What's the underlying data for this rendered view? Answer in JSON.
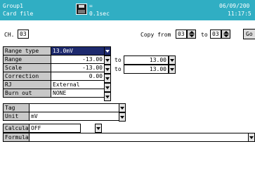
{
  "header": {
    "group": "Group1",
    "media": "Card file",
    "rate_mark": "=",
    "interval": "0.1sec",
    "date": "06/09/200",
    "time": "11:17:5"
  },
  "channel": {
    "label": "CH.",
    "value": "03"
  },
  "copy": {
    "from_label": "Copy from",
    "from_value": "03",
    "to_label": "to",
    "to_value": "03",
    "go_label": "Go"
  },
  "range": {
    "rows": [
      {
        "label": "Range type",
        "value": "13.0mV"
      },
      {
        "label": "Range",
        "value": "-13.00"
      },
      {
        "label": "Scale",
        "value": "-13.00"
      },
      {
        "label": "Correction",
        "value": "0.00"
      },
      {
        "label": "RJ",
        "value": "External"
      },
      {
        "label": "Burn out",
        "value": "NONE"
      }
    ],
    "to_label": "to",
    "range_to": "13.00",
    "scale_to": "13.00"
  },
  "tag": {
    "label": "Tag",
    "value": ""
  },
  "unit": {
    "label": "Unit",
    "value": "mV"
  },
  "calc": {
    "label": "Calculate",
    "value": "OFF"
  },
  "formula": {
    "label": "Formula",
    "value": ""
  }
}
